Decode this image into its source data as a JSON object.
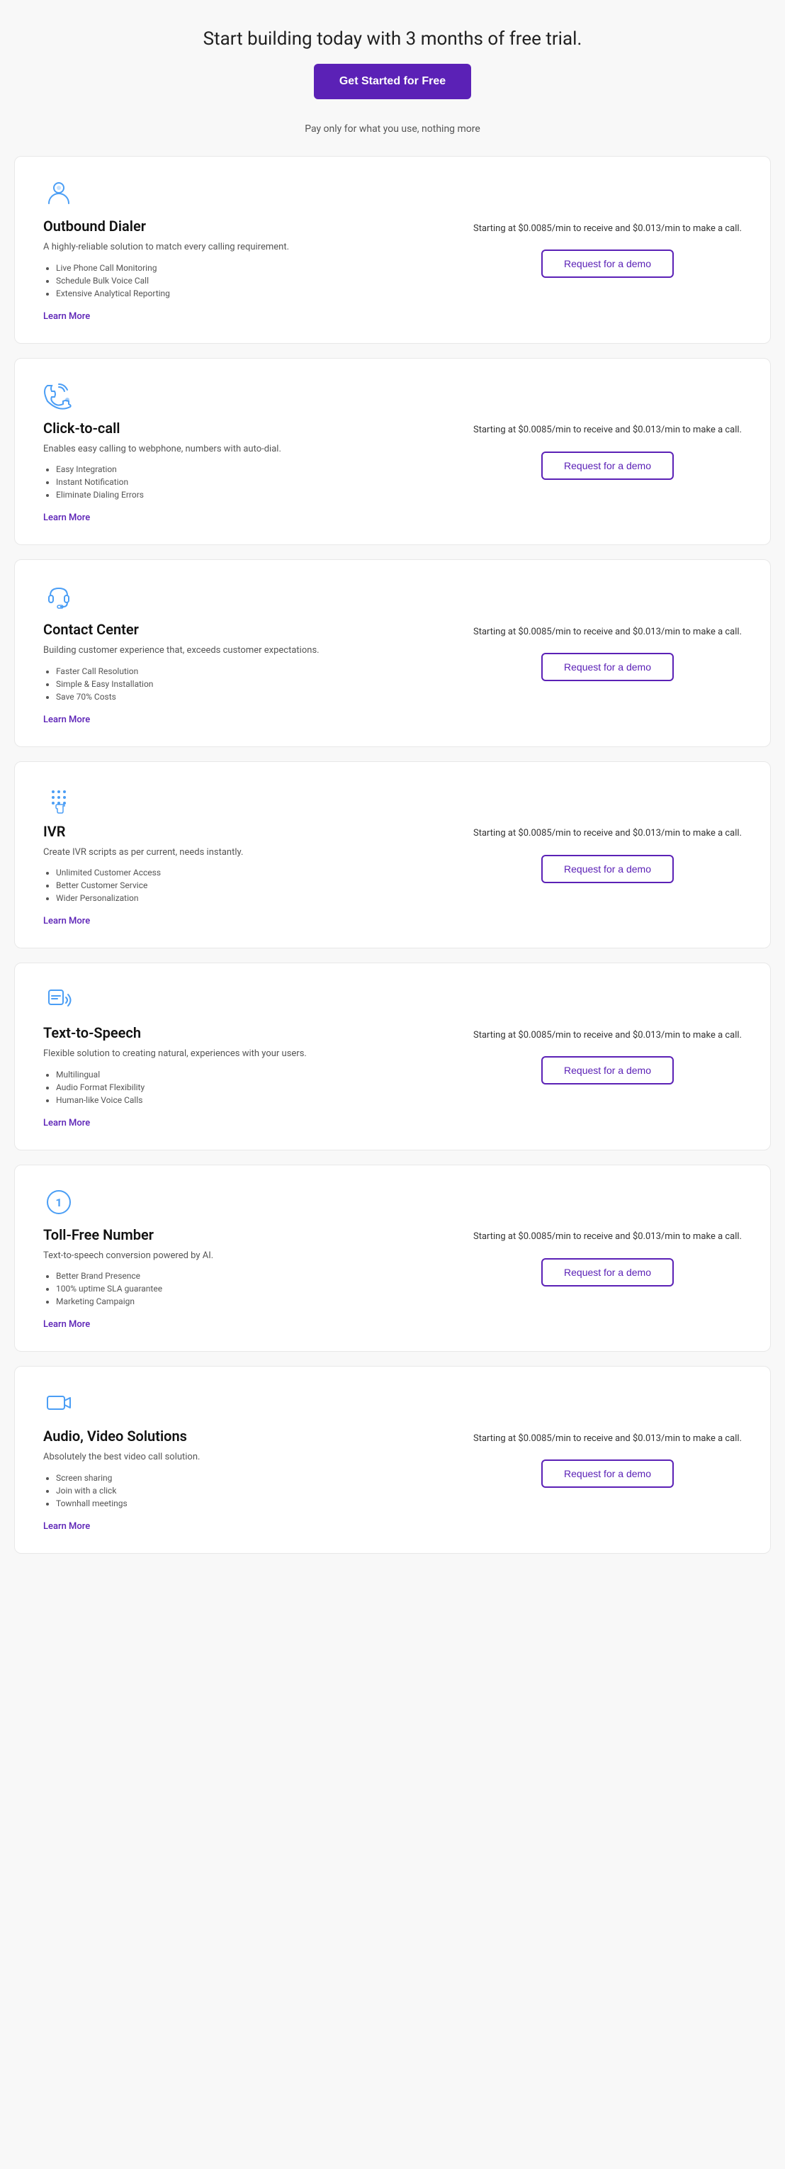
{
  "header": {
    "title": "Start building today with 3 months of free trial.",
    "cta_label": "Get Started for Free",
    "pay_note": "Pay only for what you use, nothing more"
  },
  "cards": [
    {
      "id": "outbound-dialer",
      "icon_name": "outbound-dialer-icon",
      "title": "Outbound Dialer",
      "description": "A highly-reliable solution to match every calling requirement.",
      "features": [
        "Live Phone Call Monitoring",
        "Schedule Bulk Voice Call",
        "Extensive Analytical Reporting"
      ],
      "learn_more": "Learn More",
      "price": "Starting at $0.0085/min to receive and $0.013/min to make a call.",
      "demo_label": "Request for a demo"
    },
    {
      "id": "click-to-call",
      "icon_name": "click-to-call-icon",
      "title": "Click-to-call",
      "description": "Enables easy calling to webphone, numbers with auto-dial.",
      "features": [
        "Easy Integration",
        "Instant Notification",
        "Eliminate Dialing Errors"
      ],
      "learn_more": "Learn More",
      "price": "Starting at $0.0085/min to receive and $0.013/min to make a call.",
      "demo_label": "Request for a demo"
    },
    {
      "id": "contact-center",
      "icon_name": "contact-center-icon",
      "title": "Contact Center",
      "description": "Building customer experience that, exceeds customer expectations.",
      "features": [
        "Faster Call Resolution",
        "Simple & Easy Installation",
        "Save 70% Costs"
      ],
      "learn_more": "Learn More",
      "price": "Starting at $0.0085/min to receive and $0.013/min to make a call.",
      "demo_label": "Request for a demo"
    },
    {
      "id": "ivr",
      "icon_name": "ivr-icon",
      "title": "IVR",
      "description": "Create IVR scripts as per current, needs instantly.",
      "features": [
        "Unlimited Customer Access",
        "Better Customer Service",
        "Wider Personalization"
      ],
      "learn_more": "Learn More",
      "price": "Starting at $0.0085/min to receive and $0.013/min to make a call.",
      "demo_label": "Request for a demo"
    },
    {
      "id": "text-to-speech",
      "icon_name": "text-to-speech-icon",
      "title": "Text-to-Speech",
      "description": "Flexible solution to creating natural, experiences with your users.",
      "features": [
        "Multilingual",
        "Audio Format Flexibility",
        "Human-like Voice Calls"
      ],
      "learn_more": "Learn More",
      "price": "Starting at $0.0085/min to receive and $0.013/min to make a call.",
      "demo_label": "Request for a demo"
    },
    {
      "id": "toll-free-number",
      "icon_name": "toll-free-number-icon",
      "title": "Toll-Free Number",
      "description": "Text-to-speech conversion powered by AI.",
      "features": [
        "Better Brand Presence",
        "100% uptime SLA guarantee",
        "Marketing Campaign"
      ],
      "learn_more": "Learn More",
      "price": "Starting at $0.0085/min to receive and $0.013/min to make a call.",
      "demo_label": "Request for a demo"
    },
    {
      "id": "audio-video-solutions",
      "icon_name": "audio-video-icon",
      "title": "Audio, Video Solutions",
      "description": "Absolutely the best video call solution.",
      "features": [
        "Screen sharing",
        "Join with a click",
        "Townhall meetings"
      ],
      "learn_more": "Learn More",
      "price": "Starting at $0.0085/min to receive and $0.013/min to make a call.",
      "demo_label": "Request for a demo"
    }
  ]
}
